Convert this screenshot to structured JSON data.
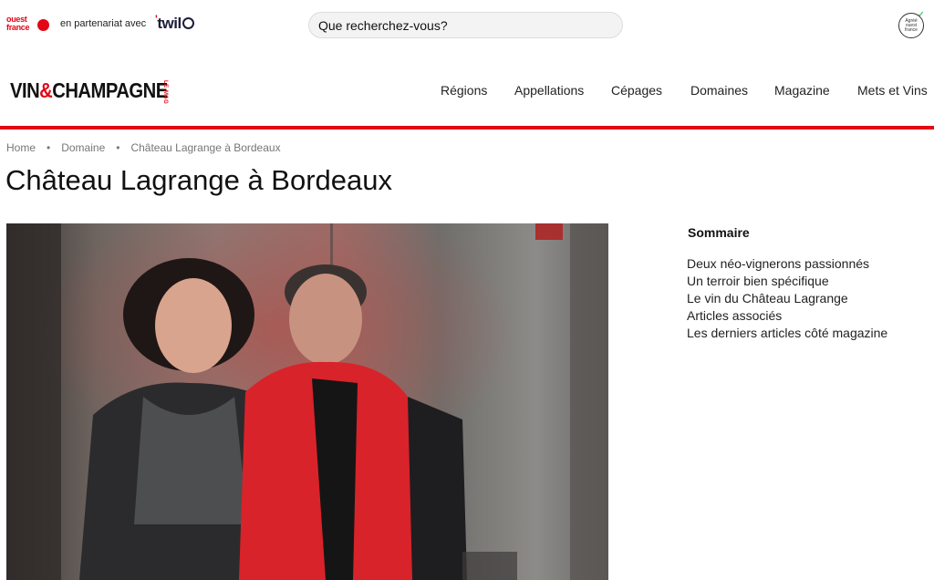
{
  "topbar": {
    "ouest_france_logo": "ouest france",
    "partner_text": "en partenariat avec",
    "twil_logo": "twil",
    "search_placeholder": "Que recherchez-vous?",
    "badge_text": "Agréé ouest france"
  },
  "header": {
    "brand": {
      "part1": "VIN",
      "amp": "&",
      "part2": "CHAMPAGNE",
      "side": "LE MAG"
    },
    "nav": [
      "Régions",
      "Appellations",
      "Cépages",
      "Domaines",
      "Magazine",
      "Mets et Vins"
    ]
  },
  "breadcrumb": [
    "Home",
    "Domaine",
    "Château Lagrange à Bordeaux"
  ],
  "page_title": "Château Lagrange à Bordeaux",
  "sommaire": {
    "title": "Sommaire",
    "items": [
      "Deux néo-vignerons passionnés",
      "Un terroir bien spécifique",
      "Le vin du Château Lagrange",
      "Articles associés",
      "Les derniers articles côté magazine"
    ]
  },
  "colors": {
    "accent": "#e30613",
    "text": "#111111"
  },
  "icons": {
    "badge": "check-icon"
  }
}
